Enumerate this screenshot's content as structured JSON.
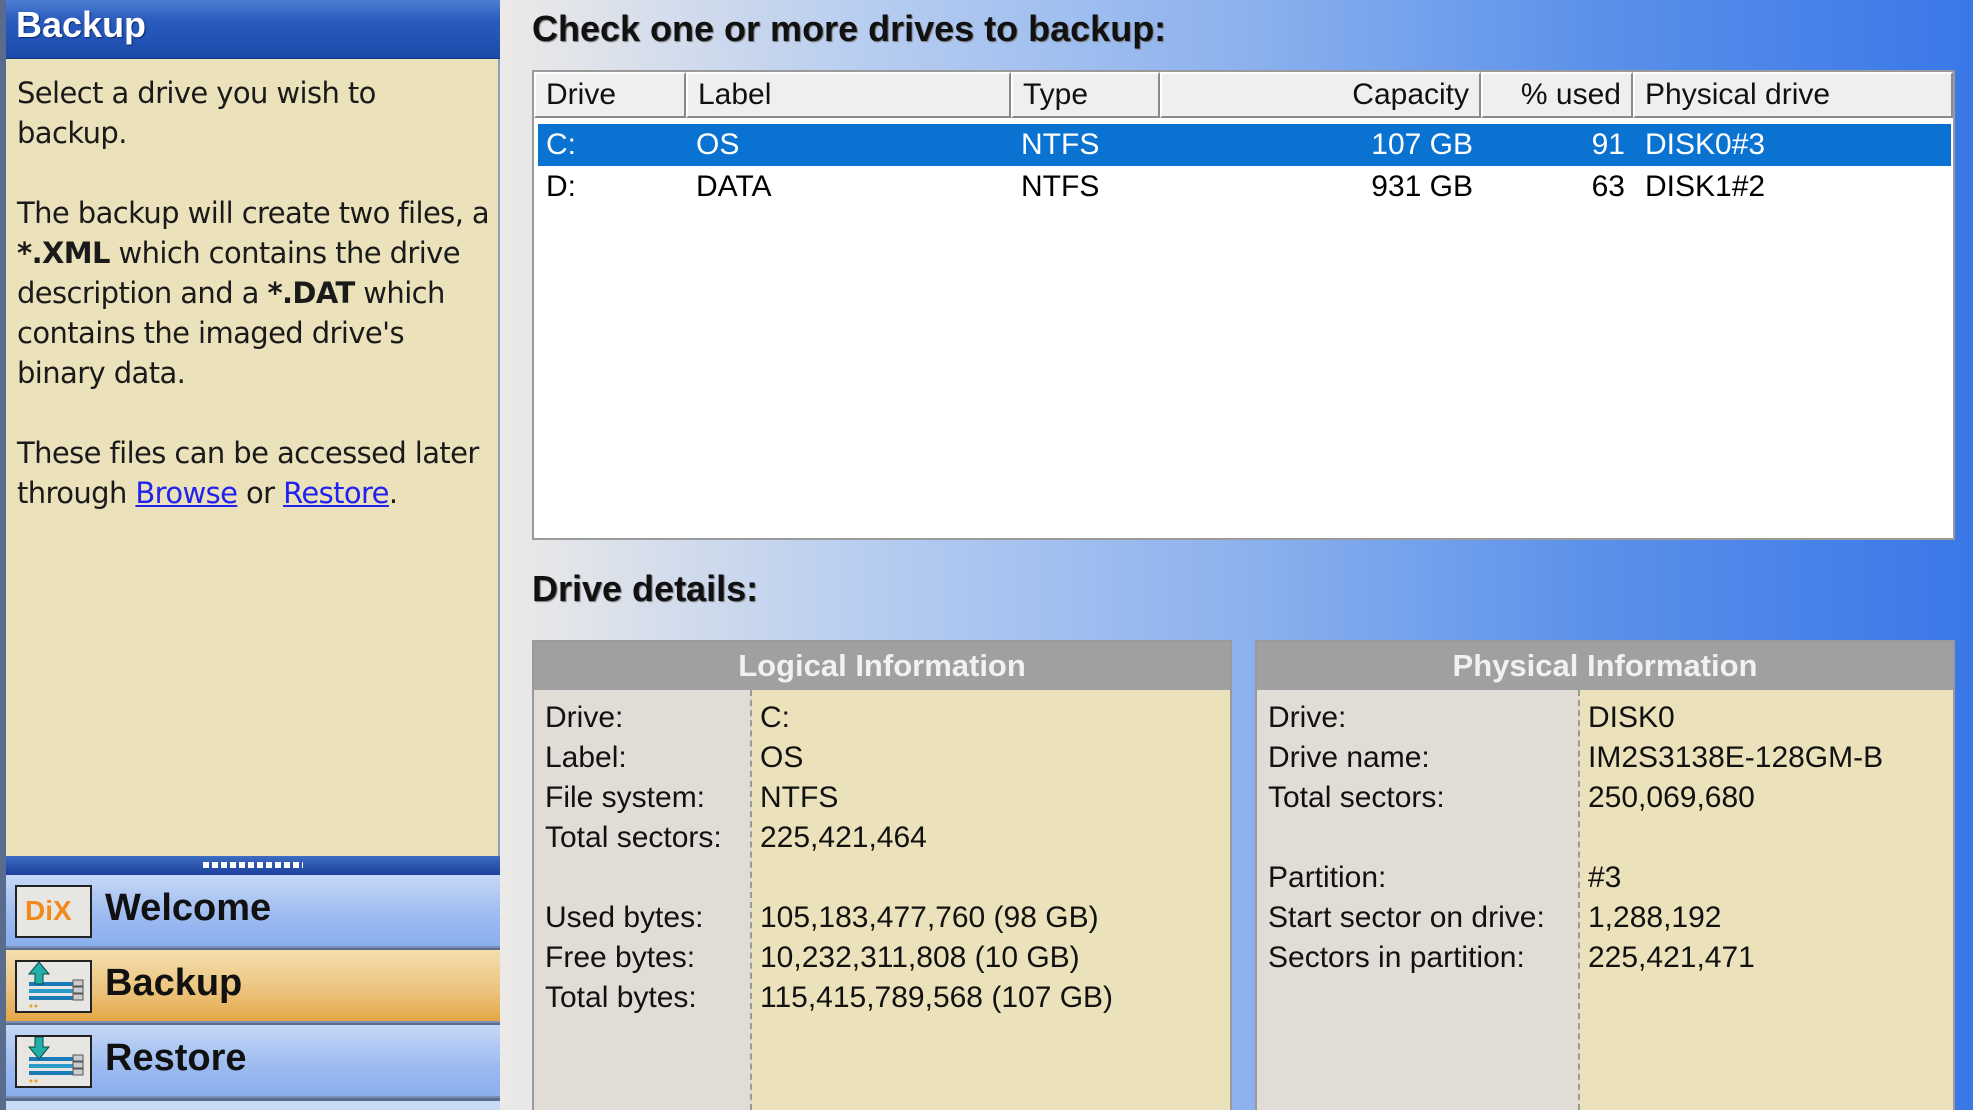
{
  "sidebar": {
    "title": "Backup",
    "help": {
      "p1": "Select a drive you wish to backup.",
      "p2_a": "The backup will create two files, a ",
      "p2_xml": " *.XML",
      "p2_b": " which contains the drive description and a ",
      "p2_dat": "*.DAT",
      "p2_c": " which contains the imaged drive's binary data.",
      "p3_a": "These files can be accessed later through ",
      "link_browse": "Browse",
      "p3_or": " or ",
      "link_restore": "Restore",
      "p3_end": "."
    },
    "nav": [
      {
        "label": "Welcome",
        "icon": "dix-logo-icon",
        "active": false
      },
      {
        "label": "Backup",
        "icon": "backup-drive-icon",
        "active": true
      },
      {
        "label": "Restore",
        "icon": "restore-drive-icon",
        "active": false
      }
    ],
    "dix_logo_text": "DiX"
  },
  "main": {
    "table_title": "Check one or more drives to backup:",
    "columns": [
      "Drive",
      "Label",
      "Type",
      "Capacity",
      "% used",
      "Physical drive"
    ],
    "rows": [
      {
        "drive": "C:",
        "label": "OS",
        "type": "NTFS",
        "capacity": "107 GB",
        "used": "91",
        "physical": "DISK0#3",
        "selected": true
      },
      {
        "drive": "D:",
        "label": "DATA",
        "type": "NTFS",
        "capacity": "931 GB",
        "used": "63",
        "physical": "DISK1#2",
        "selected": false
      }
    ],
    "details_title": "Drive details:",
    "logical": {
      "title": "Logical Information",
      "fields": [
        {
          "label": "Drive:",
          "value": "C:"
        },
        {
          "label": "Label:",
          "value": "OS"
        },
        {
          "label": "File system:",
          "value": "NTFS"
        },
        {
          "label": "Total sectors:",
          "value": "225,421,464"
        },
        {
          "label": "Used bytes:",
          "value": "105,183,477,760 (98 GB)"
        },
        {
          "label": "Free bytes:",
          "value": "10,232,311,808 (10 GB)"
        },
        {
          "label": "Total bytes:",
          "value": "115,415,789,568 (107 GB)"
        }
      ]
    },
    "physical": {
      "title": "Physical Information",
      "fields": [
        {
          "label": "Drive:",
          "value": "DISK0"
        },
        {
          "label": "Drive name:",
          "value": "IM2S3138E-128GM-B"
        },
        {
          "label": "Total sectors:",
          "value": "250,069,680"
        },
        {
          "label": "Partition:",
          "value": "#3"
        },
        {
          "label": "Start sector on drive:",
          "value": "1,288,192"
        },
        {
          "label": "Sectors in partition:",
          "value": "225,421,471"
        }
      ]
    }
  },
  "colors": {
    "selection": "#0a73d2",
    "help_bg": "#ebe2bb",
    "active_nav": "#e4a645",
    "link": "#2222ee"
  }
}
